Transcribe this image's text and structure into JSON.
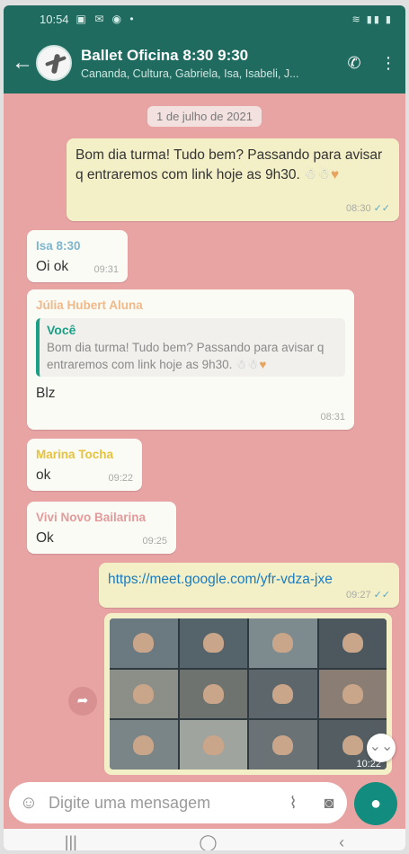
{
  "status_bar": {
    "time": "10:54",
    "left_icons": "▣ ✉ ◉ •",
    "right_icons": "≋ ▮▮ ▮"
  },
  "header": {
    "back_glyph": "←",
    "title": "Ballet Oficina 8:30 9:30",
    "members": "Cananda, Cultura, Gabriela, Isa, Isabeli, J...",
    "call_glyph": "✆",
    "menu_glyph": "⋮"
  },
  "chat": {
    "date_chip": "1 de julho de 2021",
    "messages": [
      {
        "direction": "out",
        "text": "Bom dia turma! Tudo bem? Passando para avisar q entraremos com link hoje as 9h30.",
        "emoji_text": "☃☃",
        "heart": "♥",
        "time": "08:30",
        "ticks": "✓✓"
      },
      {
        "direction": "in",
        "sender": "Isa 8:30",
        "sender_color": "#7db6ce",
        "text": "Oi ok",
        "time": "09:31"
      },
      {
        "direction": "in",
        "sender": "Júlia Hubert Aluna",
        "sender_color": "#f0b98a",
        "quote_author": "Você",
        "quote_text": "Bom dia turma! Tudo bem? Passando para avisar q entraremos com link hoje as 9h30.",
        "quote_emoji": "☃☃",
        "quote_heart": "♥",
        "text": "Blz",
        "time": "08:31"
      },
      {
        "direction": "in",
        "sender": "Marina Tocha",
        "sender_color": "#e6c23d",
        "text": "ok",
        "time": "09:22"
      },
      {
        "direction": "in",
        "sender": "Vivi Novo Bailarina",
        "sender_color": "#e39a9a",
        "text": "Ok",
        "time": "09:25"
      },
      {
        "direction": "out",
        "text": "https://meet.google.com/yfr-vdza-jxe",
        "time": "09:27",
        "ticks": "✓✓"
      },
      {
        "direction": "out",
        "type": "image",
        "time": "10:22"
      }
    ],
    "forward_glyph": "➦",
    "scroll_down_glyph": "⌄⌄"
  },
  "input": {
    "placeholder": "Digite uma mensagem",
    "emoji_glyph": "☺",
    "attach_glyph": "⌇",
    "camera_glyph": "◙",
    "mic_glyph": "●"
  },
  "navbar": {
    "recent": "|||",
    "home": "◯",
    "back": "‹"
  }
}
